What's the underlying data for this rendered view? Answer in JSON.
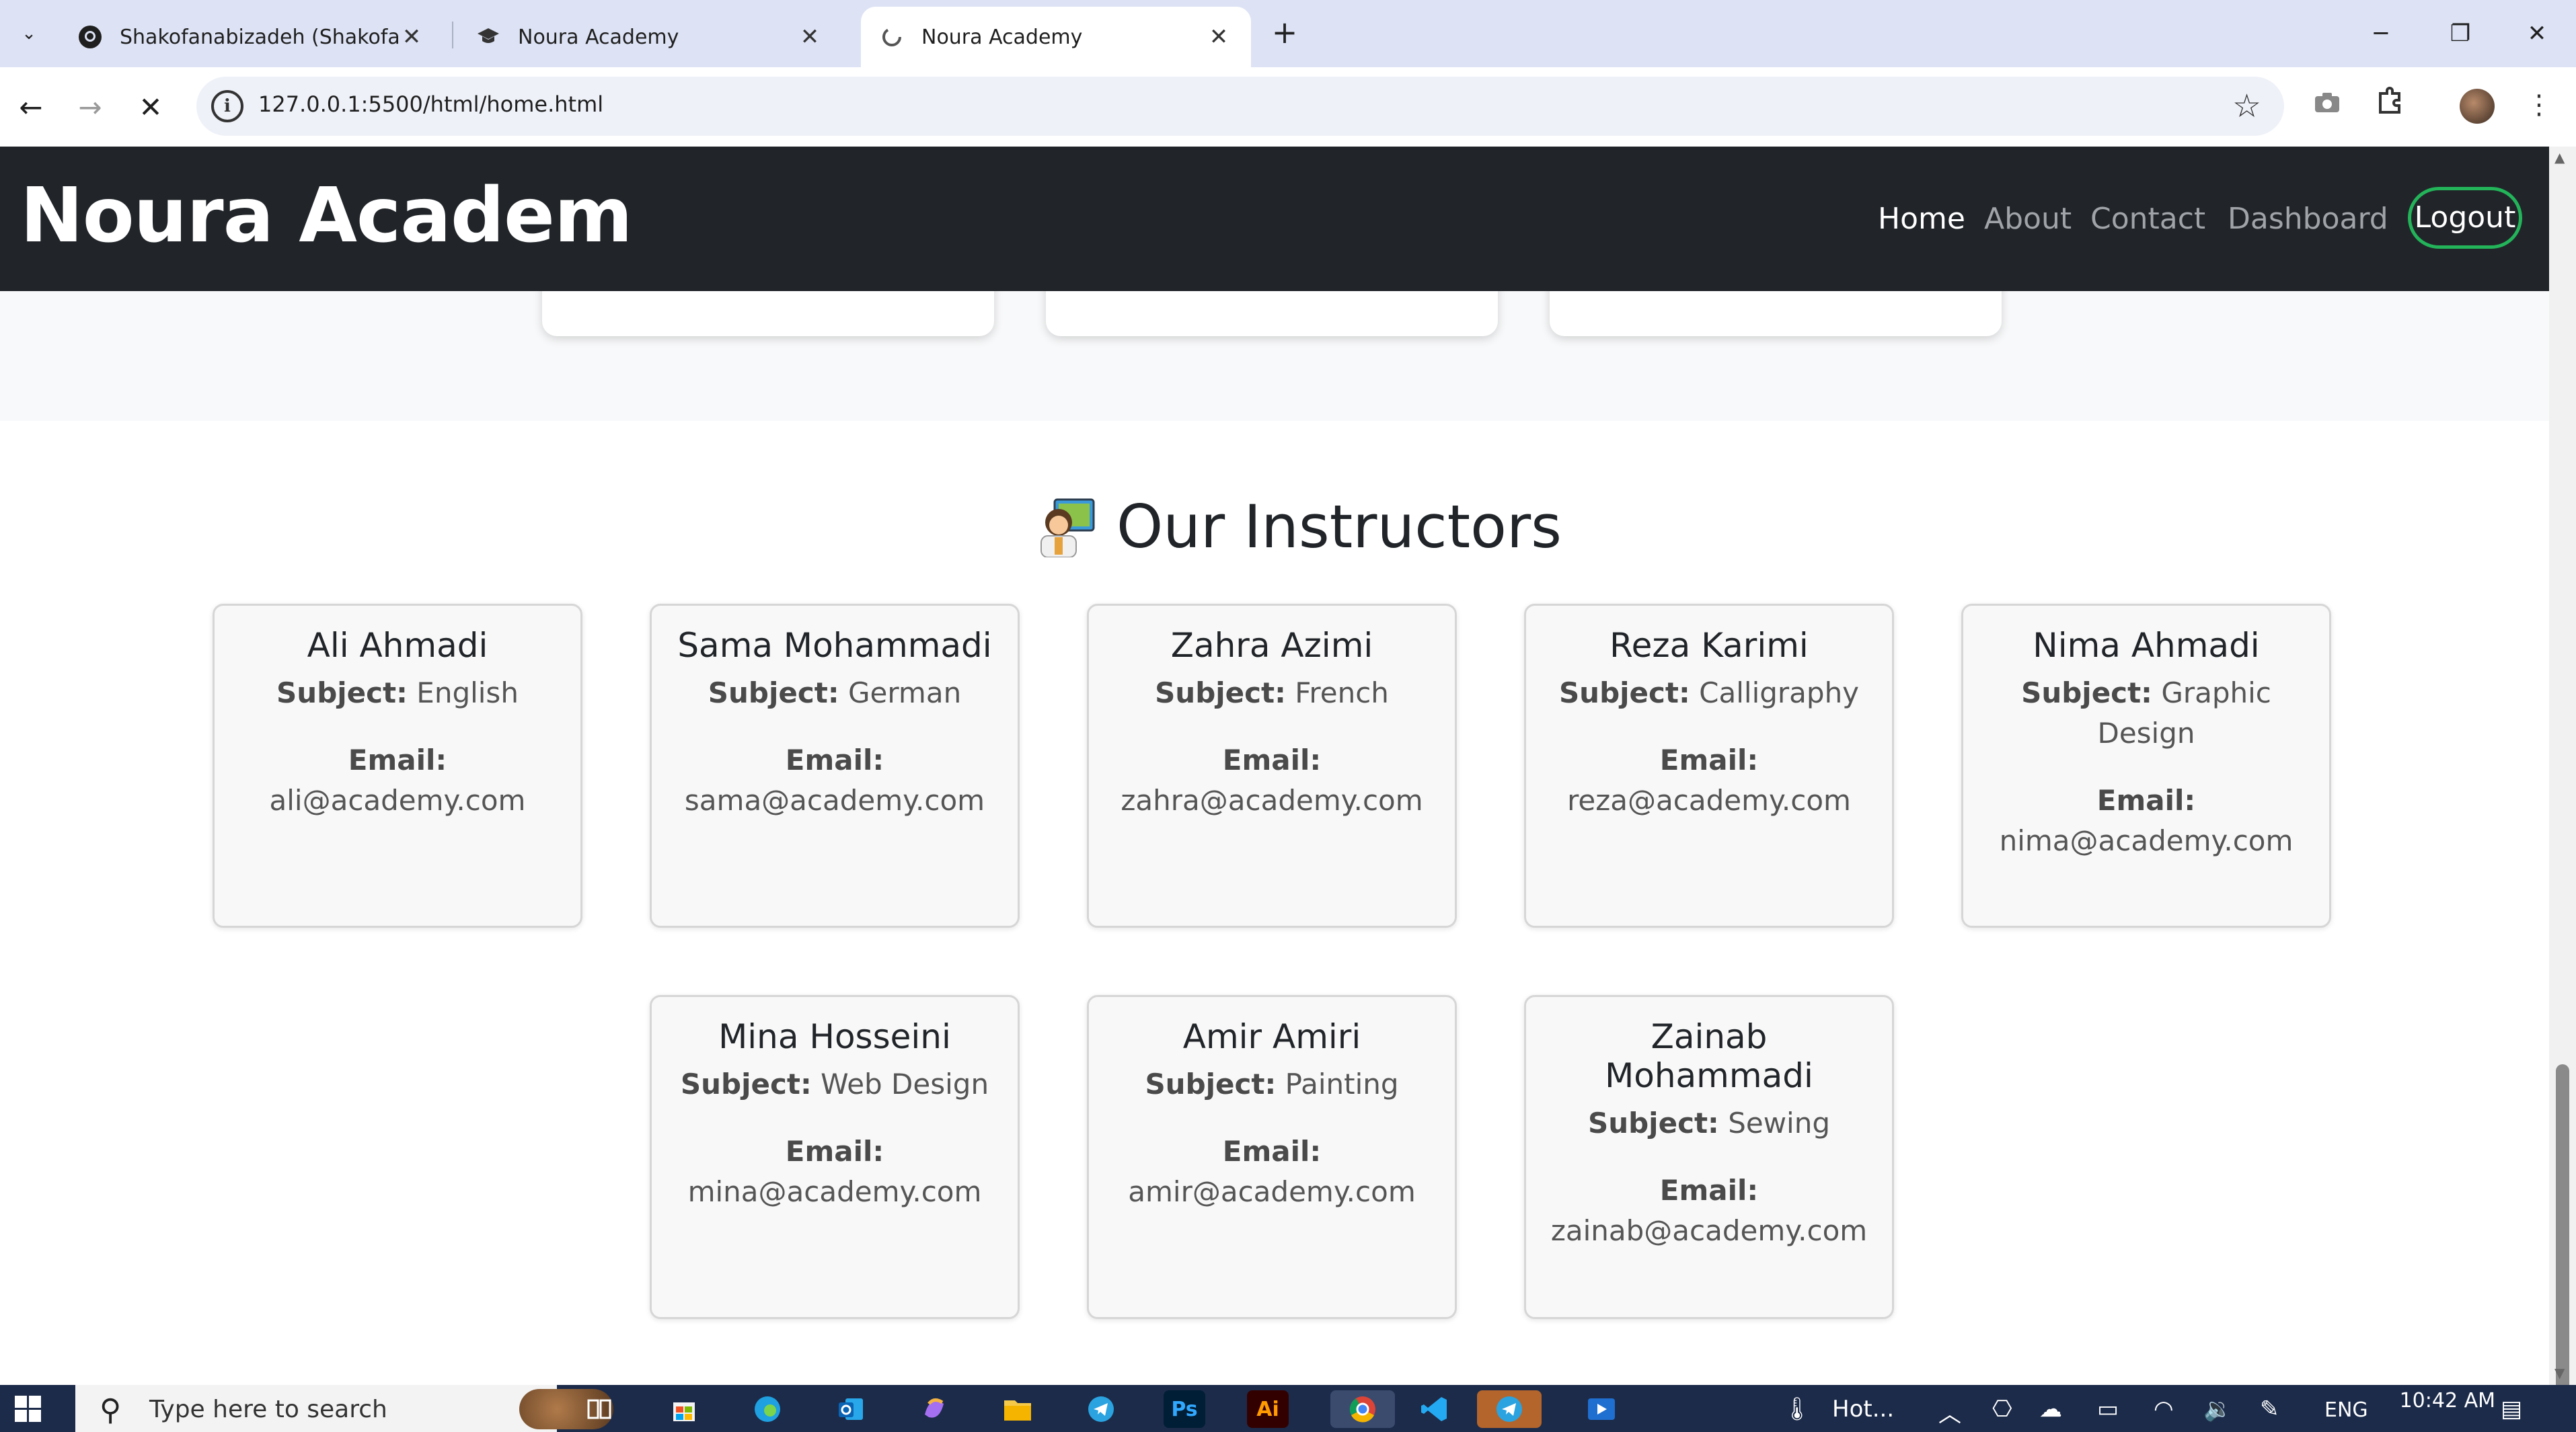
{
  "browser": {
    "tabs": [
      {
        "title": "Shakofanabizadeh (Shakofa_Na",
        "icon": "github-icon"
      },
      {
        "title": "Noura Academy",
        "icon": "graduation-cap-icon"
      },
      {
        "title": "Noura Academy",
        "icon": "loading-icon"
      }
    ],
    "url": "127.0.0.1:5500/html/home.html"
  },
  "site": {
    "brand": "Noura Academ",
    "nav": {
      "home": "Home",
      "about": "About",
      "contact": "Contact",
      "dashboard": "Dashboard",
      "logout": "Logout"
    }
  },
  "instructors": {
    "title": "Our Instructors",
    "subject_label": "Subject:",
    "email_label": "Email:",
    "items": [
      {
        "name": "Ali Ahmadi",
        "subject": "English",
        "email": "ali@academy.com"
      },
      {
        "name": "Sama Mohammadi",
        "subject": "German",
        "email": "sama@academy.com"
      },
      {
        "name": "Zahra Azimi",
        "subject": "French",
        "email": "zahra@academy.com"
      },
      {
        "name": "Reza Karimi",
        "subject": "Calligraphy",
        "email": "reza@academy.com"
      },
      {
        "name": "Nima Ahmadi",
        "subject": "Graphic Design",
        "email": "nima@academy.com"
      },
      {
        "name": "Mina Hosseini",
        "subject": "Web Design",
        "email": "mina@academy.com"
      },
      {
        "name": "Amir Amiri",
        "subject": "Painting",
        "email": "amir@academy.com"
      },
      {
        "name": "Zainab Mohammadi",
        "subject": "Sewing",
        "email": "zainab@academy.com"
      }
    ]
  },
  "taskbar": {
    "search_placeholder": "Type here to search",
    "weather": "Hot...",
    "language": "ENG",
    "time": "10:42 AM"
  },
  "colors": {
    "navbar_bg": "#212529",
    "logout_border": "#23b45a",
    "section_bg": "#f8f9fa"
  }
}
